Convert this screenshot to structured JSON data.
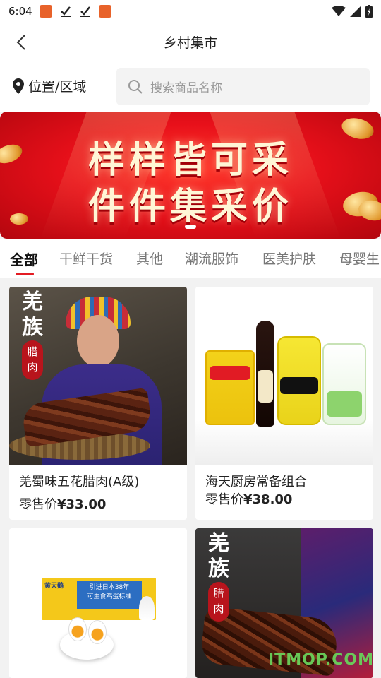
{
  "status_bar": {
    "time": "6:04"
  },
  "header": {
    "title": "乡村集市"
  },
  "search": {
    "location_label": "位置/区域",
    "placeholder": "搜索商品名称"
  },
  "banner": {
    "line1": "样样皆可采",
    "line2": "件件集采价"
  },
  "tabs": [
    {
      "label": "全部",
      "active": true
    },
    {
      "label": "干鲜干货"
    },
    {
      "label": "其他"
    },
    {
      "label": "潮流服饰"
    },
    {
      "label": "医美护肤"
    },
    {
      "label": "母婴生"
    }
  ],
  "products": [
    {
      "name": "羌蜀味五花腊肉(A级)",
      "price_label": "零售价",
      "price": "¥33.00",
      "image_text": [
        "羌",
        "族",
        "腊",
        "肉"
      ]
    },
    {
      "name": "海天厨房常备组合",
      "price_label": "零售价",
      "price": "¥38.00"
    },
    {
      "name": "",
      "price_label": "",
      "price": "",
      "image_text": [
        "黄天鹅",
        "引进日本38年",
        "可生食鸡蛋标准"
      ]
    },
    {
      "name": "",
      "price_label": "",
      "price": "",
      "image_text": [
        "羌",
        "族",
        "腊",
        "肉"
      ]
    }
  ],
  "watermark": "ITMOP.COM",
  "colors": {
    "accent": "#e31c23",
    "banner_red": "#e8101a"
  }
}
